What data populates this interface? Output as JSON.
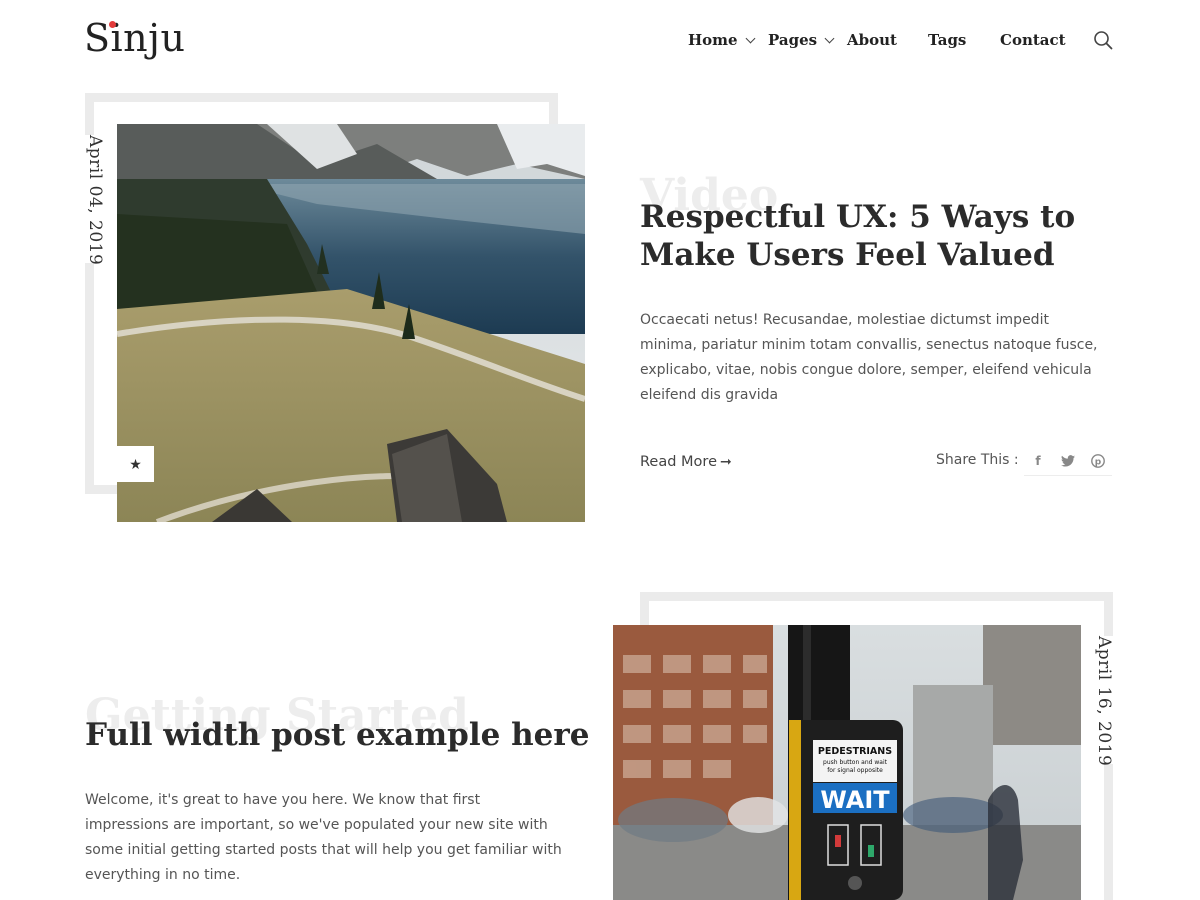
{
  "site": {
    "logo": "Sinju"
  },
  "nav": {
    "items": [
      {
        "label": "Home",
        "has_dropdown": true
      },
      {
        "label": "Pages",
        "has_dropdown": true
      },
      {
        "label": "About",
        "has_dropdown": false
      },
      {
        "label": "Tags",
        "has_dropdown": false
      },
      {
        "label": "Contact",
        "has_dropdown": false
      }
    ],
    "search_icon": "search-icon"
  },
  "posts": [
    {
      "date": "April 04, 2019",
      "category_ghost": "Video",
      "title": "Respectful UX: 5 Ways to Make Users Feel Valued",
      "excerpt": "Occaecati netus! Recusandae, molestiae dictumst impedit minima, pariatur minim totam convallis, senectus natoque fusce, explicabo, vitae, nobis congue dolore, semper, eleifend vehicula eleifend dis gravida",
      "read_more": "Read More",
      "share_label": "Share This :",
      "share_icons": [
        "facebook-icon",
        "twitter-icon",
        "pinterest-icon"
      ],
      "featured_icon": "star-icon",
      "image": "mountain-lake-landscape"
    },
    {
      "date": "April 16, 2019",
      "category_ghost": "Getting Started",
      "title": "Full width post example here",
      "excerpt": "Welcome, it's great to have you here. We know that first impressions are important, so we've populated your new site with some initial getting started posts that will help you get familiar with everything in no time.",
      "image": "pedestrian-crossing-button",
      "sign": {
        "top": "PEDESTRIANS",
        "middle": "push button and wait for signal opposite",
        "bottom": "WAIT"
      }
    }
  ],
  "colors": {
    "accent_dot": "#e23b3b",
    "frame": "#ebebeb",
    "text": "#2b2b2b"
  }
}
